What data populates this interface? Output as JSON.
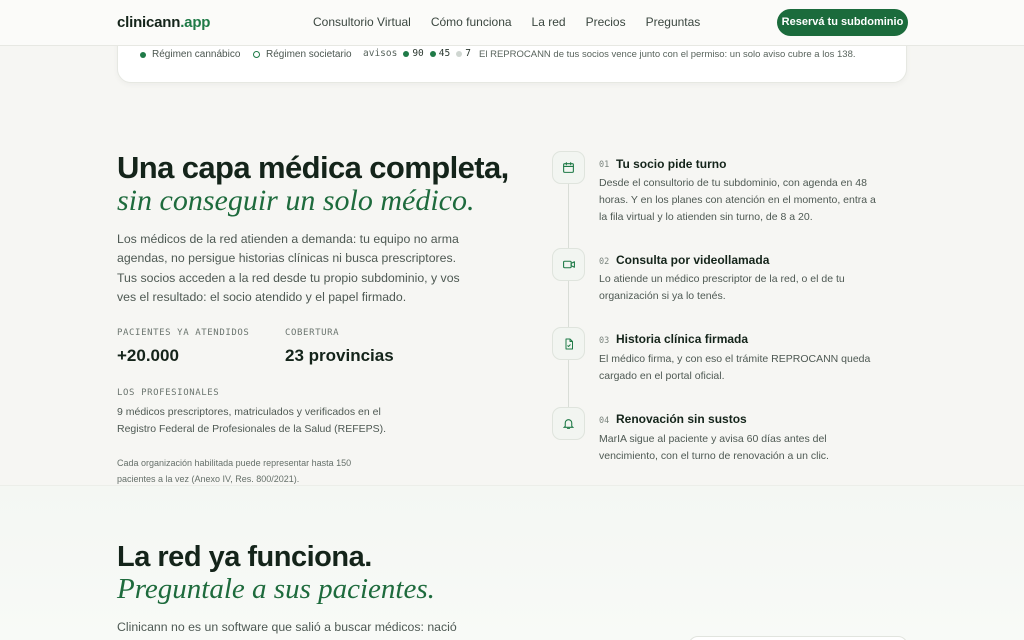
{
  "nav": {
    "brand_name": "clinicann",
    "brand_tld": ".app",
    "links": [
      "Consultorio Virtual",
      "Cómo funciona",
      "La red",
      "Precios",
      "Preguntas"
    ],
    "cta": "Reservá tu subdominio"
  },
  "topcard": {
    "legend_cannabico": "Régimen cannábico",
    "legend_societario": "Régimen societario",
    "avisos_label": "avisos",
    "count_green": "90",
    "count_mid": "45",
    "count_pale": "7",
    "note": "El REPROCANN de tus socios vence junto con el permiso: un solo aviso cubre a los 138."
  },
  "hero": {
    "title": "Una capa médica completa,",
    "title_italic": "sin conseguir un solo médico.",
    "lead": "Los médicos de la red atienden a demanda: tu equipo no arma agendas, no persigue historias clínicas ni busca prescriptores. Tus socios acceden a la red desde tu propio subdominio, y vos ves el resultado: el socio atendido y el papel firmado.",
    "stat1_label": "PACIENTES YA ATENDIDOS",
    "stat1_value": "+20.000",
    "stat2_label": "COBERTURA",
    "stat2_value": "23 provincias",
    "prof_label": "LOS PROFESIONALES",
    "prof_text": "9 médicos prescriptores, matriculados y verificados en el Registro Federal de Profesionales de la Salud (REFEPS).",
    "fine_print": "Cada organización habilitada puede representar hasta 150 pacientes a la vez (Anexo IV, Res. 800/2021)."
  },
  "steps": [
    {
      "num": "01",
      "title": "Tu socio pide turno",
      "desc": "Desde el consultorio de tu subdominio, con agenda en 48 horas. Y en los planes con atención en el momento, entra a la fila virtual y lo atienden sin turno, de 8 a 20.",
      "icon": "calendar-icon"
    },
    {
      "num": "02",
      "title": "Consulta por videollamada",
      "desc": "Lo atiende un médico prescriptor de la red, o el de tu organización si ya lo tenés.",
      "icon": "video-icon"
    },
    {
      "num": "03",
      "title": "Historia clínica firmada",
      "desc": "El médico firma, y con eso el trámite REPROCANN queda cargado en el portal oficial.",
      "icon": "document-icon"
    },
    {
      "num": "04",
      "title": "Renovación sin sustos",
      "desc": "MarIA sigue al paciente y avisa 60 días antes del vencimiento, con el turno de renovación a un clic.",
      "icon": "bell-icon"
    }
  ],
  "network": {
    "title": "La red ya funciona.",
    "title_italic": "Preguntale a sus pacientes.",
    "lead": "Clinicann no es un software que salió a buscar médicos: nació"
  },
  "colors": {
    "accent": "#1b6b3c",
    "italic_green": "#1e6b3d",
    "background": "#f6f6f3"
  }
}
